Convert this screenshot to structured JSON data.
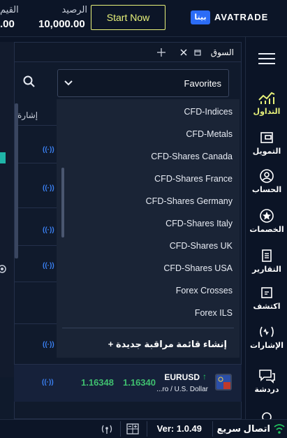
{
  "header": {
    "value_label": "القيم",
    "value_amount": ".00",
    "balance_label": "الرصيد",
    "balance_amount": "10,000.00",
    "start_button": "Start Now",
    "beta_badge": "بيتا",
    "logo_text": "AVATRADE"
  },
  "sidebar": {
    "items": [
      {
        "label": "التداول",
        "icon": "chart-icon",
        "active": true
      },
      {
        "label": "التمويل",
        "icon": "wallet-icon"
      },
      {
        "label": "الحساب",
        "icon": "user-icon"
      },
      {
        "label": "الخصمات",
        "icon": "star-icon"
      },
      {
        "label": "التقارير",
        "icon": "report-icon"
      },
      {
        "label": "اكتشف",
        "icon": "discover-icon"
      },
      {
        "label": "الإشارات",
        "icon": "signal-icon"
      },
      {
        "label": "دردشة",
        "icon": "chat-icon"
      }
    ]
  },
  "market": {
    "title": "السوق",
    "column_signal": "إشارة",
    "dropdown_value": "Favorites",
    "signal_glyph": "((·))"
  },
  "menu": {
    "items": [
      "CFD-Indices",
      "CFD-Metals",
      "CFD-Shares Canada",
      "CFD-Shares France",
      "CFD-Shares Germany",
      "CFD-Shares Italy",
      "CFD-Shares UK",
      "CFD-Shares USA",
      "Forex Crosses",
      "Forex ILS"
    ],
    "create_watchlist": "+  إنشاء قائمة مراقبة جديدة"
  },
  "eurusd": {
    "symbol": "EURUSD",
    "description": "...ro / U.S. Dollar",
    "sell": "1.16340",
    "buy": "1.16348"
  },
  "footer": {
    "connection": "اتصال سريع",
    "version": "Ver: 1.0.49"
  },
  "colors": {
    "accent": "#e8f27a",
    "signal": "#3b82f6",
    "price_up": "#3fbf6f"
  }
}
